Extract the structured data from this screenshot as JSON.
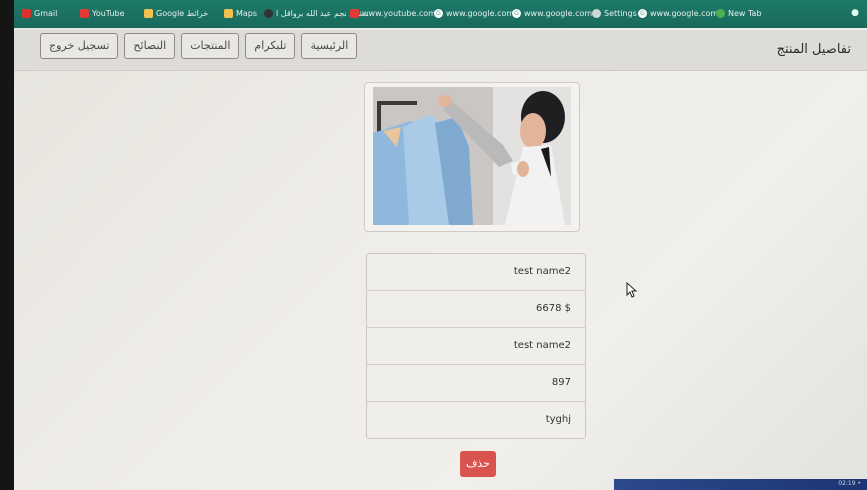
{
  "bookmarks": [
    {
      "label": "Gmail",
      "icon": "gmail-icon"
    },
    {
      "label": "YouTube",
      "icon": "youtube-icon"
    },
    {
      "label": "Google خرائط",
      "icon": "maps-icon"
    },
    {
      "label": "Maps",
      "icon": "maps-icon"
    },
    {
      "label": "شهد نجم عبد الله برواقل ا...",
      "icon": "bookmark-icon"
    },
    {
      "label": "www.youtube.com",
      "icon": "youtube-icon"
    },
    {
      "label": "www.google.com",
      "icon": "google-icon"
    },
    {
      "label": "www.google.com",
      "icon": "google-icon"
    },
    {
      "label": "Settings",
      "icon": "settings-icon"
    },
    {
      "label": "www.google.com",
      "icon": "google-icon"
    },
    {
      "label": "New Tab",
      "icon": "chrome-icon"
    }
  ],
  "header": {
    "title": "تفاصيل المنتج",
    "nav": [
      "الرئيسية",
      "تلبكرام",
      "المنتجات",
      "النصائح",
      "تسجيل خروج"
    ]
  },
  "product": {
    "details": [
      "test name2",
      "6678 $",
      "test name2",
      "897",
      "tyghj"
    ],
    "delete_label": "حذف"
  },
  "taskbar": {
    "clock": "02:19 •"
  }
}
